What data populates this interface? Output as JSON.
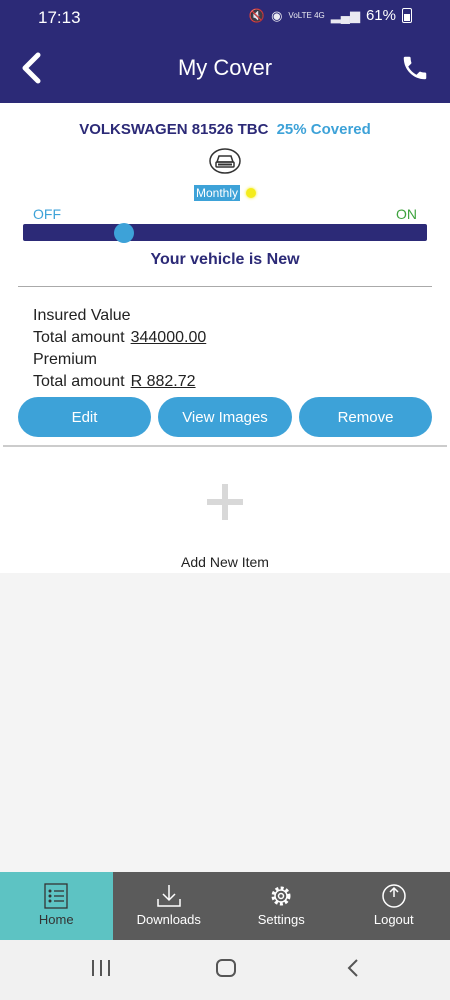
{
  "status": {
    "time": "17:13",
    "network": "VoLTE 4G",
    "battery": "61%"
  },
  "header": {
    "title": "My Cover"
  },
  "vehicle": {
    "name": "VOLKSWAGEN 81526 TBC",
    "coverage": "25% Covered",
    "frequency": "Monthly",
    "status_text": "Your vehicle is New"
  },
  "toggle": {
    "off_label": "OFF",
    "on_label": "ON",
    "level": 0.25
  },
  "insured": {
    "label": "Insured Value",
    "amount_label": "Total amount",
    "amount": "344000.00"
  },
  "premium": {
    "label": "Premium",
    "amount_label": "Total amount",
    "amount": "R 882.72"
  },
  "actions": {
    "edit": "Edit",
    "view_images": "View Images",
    "remove": "Remove"
  },
  "add_item": {
    "label": "Add New Item"
  },
  "nav": [
    {
      "label": "Home",
      "icon": "list-icon",
      "active": true
    },
    {
      "label": "Downloads",
      "icon": "download-icon",
      "active": false
    },
    {
      "label": "Settings",
      "icon": "gear-icon",
      "active": false
    },
    {
      "label": "Logout",
      "icon": "power-icon",
      "active": false
    }
  ],
  "colors": {
    "header_bg": "#2c2a77",
    "accent": "#3da2d8",
    "on_green": "#3ea33e",
    "nav_bg": "#5b5b5b",
    "nav_active": "#5dc3c3"
  }
}
